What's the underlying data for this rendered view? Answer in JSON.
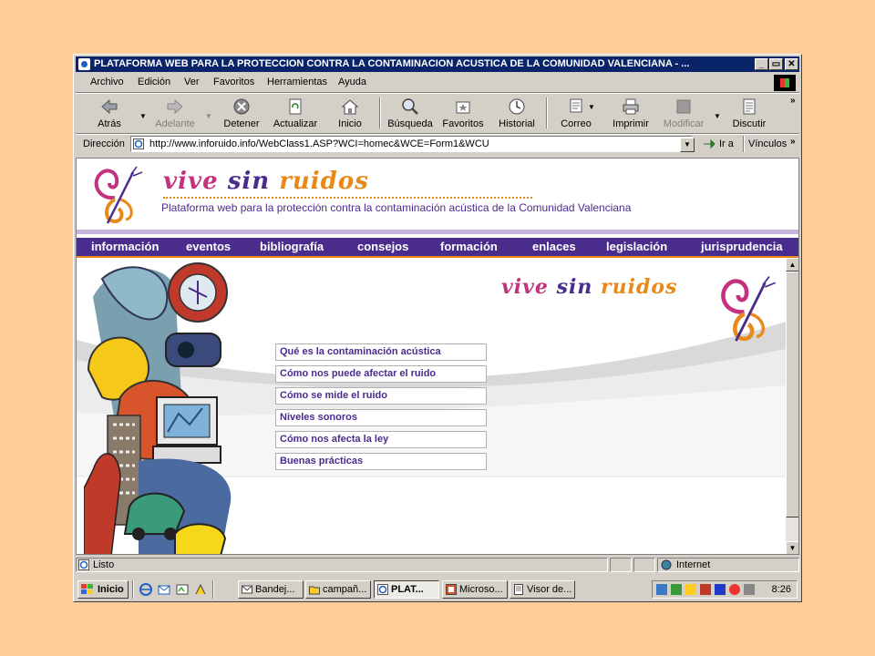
{
  "window": {
    "title": "PLATAFORMA WEB PARA LA PROTECCION CONTRA LA CONTAMINACION ACUSTICA DE LA COMUNIDAD VALENCIANA - ..."
  },
  "menubar": {
    "items": [
      "Archivo",
      "Edición",
      "Ver",
      "Favoritos",
      "Herramientas",
      "Ayuda"
    ]
  },
  "toolbar": {
    "buttons": [
      {
        "label": "Atrás",
        "enabled": true,
        "icon": "back-arrow-icon"
      },
      {
        "label": "Adelante",
        "enabled": false,
        "icon": "forward-arrow-icon"
      },
      {
        "label": "Detener",
        "enabled": true,
        "icon": "stop-icon"
      },
      {
        "label": "Actualizar",
        "enabled": true,
        "icon": "refresh-icon"
      },
      {
        "label": "Inicio",
        "enabled": true,
        "icon": "home-icon"
      },
      {
        "label": "Búsqueda",
        "enabled": true,
        "icon": "search-icon"
      },
      {
        "label": "Favoritos",
        "enabled": true,
        "icon": "favorites-icon"
      },
      {
        "label": "Historial",
        "enabled": true,
        "icon": "history-icon"
      },
      {
        "label": "Correo",
        "enabled": true,
        "icon": "mail-icon"
      },
      {
        "label": "Imprimir",
        "enabled": true,
        "icon": "printer-icon"
      },
      {
        "label": "Modificar",
        "enabled": false,
        "icon": "edit-icon"
      },
      {
        "label": "Discutir",
        "enabled": true,
        "icon": "discuss-icon"
      }
    ]
  },
  "addressbar": {
    "label": "Dirección",
    "url": "http://www.inforuido.info/WebClass1.ASP?WCI=homec&WCE=Form1&WCU",
    "go_label": "Ir a",
    "links_label": "Vínculos"
  },
  "page": {
    "brand": {
      "vive": "vive",
      "sin": "sin",
      "ruidos": "ruidos"
    },
    "subtitle": "Plataforma web para la protección contra la contaminación acústica de la Comunidad Valenciana",
    "nav": [
      "información",
      "eventos",
      "bibliografía",
      "consejos",
      "formación",
      "enlaces",
      "legislación",
      "jurisprudencia"
    ],
    "links": [
      "Qué es la contaminación acústica",
      "Cómo nos puede afectar el ruido",
      "Cómo se mide el ruido",
      "Niveles sonoros",
      "Cómo nos afecta la ley",
      "Buenas prácticas"
    ]
  },
  "statusbar": {
    "text": "Listo",
    "zone": "Internet"
  },
  "taskbar": {
    "start": "Inicio",
    "tasks": [
      {
        "label": "Bandej...",
        "active": false
      },
      {
        "label": "campañ...",
        "active": false
      },
      {
        "label": "PLAT...",
        "active": true
      },
      {
        "label": "Microso...",
        "active": false
      },
      {
        "label": "Visor de...",
        "active": false
      }
    ],
    "clock": "8:26"
  },
  "colors": {
    "desktop": "#fdcc99",
    "titlebar": "#0a246a",
    "nav": "#4a2c8c",
    "accent_orange": "#e88a1a",
    "accent_pink": "#c4327f",
    "link_text": "#4a2c8c"
  }
}
